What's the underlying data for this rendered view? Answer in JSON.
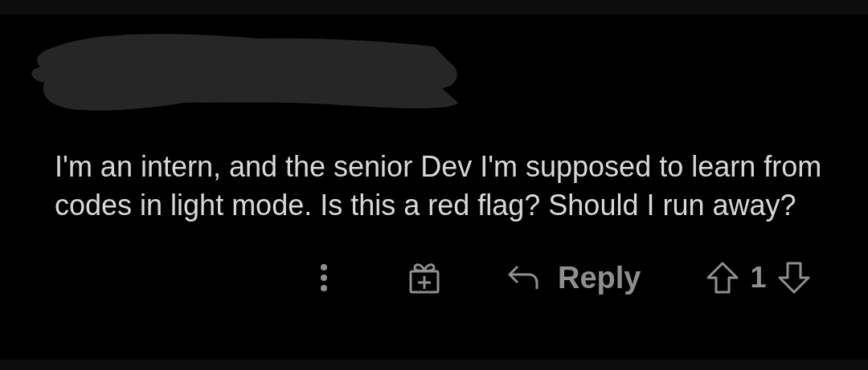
{
  "comment": {
    "body": "I'm an intern, and the senior Dev I'm supposed to learn from codes in light mode. Is this a red flag? Should I run away?"
  },
  "actions": {
    "reply_label": "Reply",
    "vote_count": "1"
  }
}
